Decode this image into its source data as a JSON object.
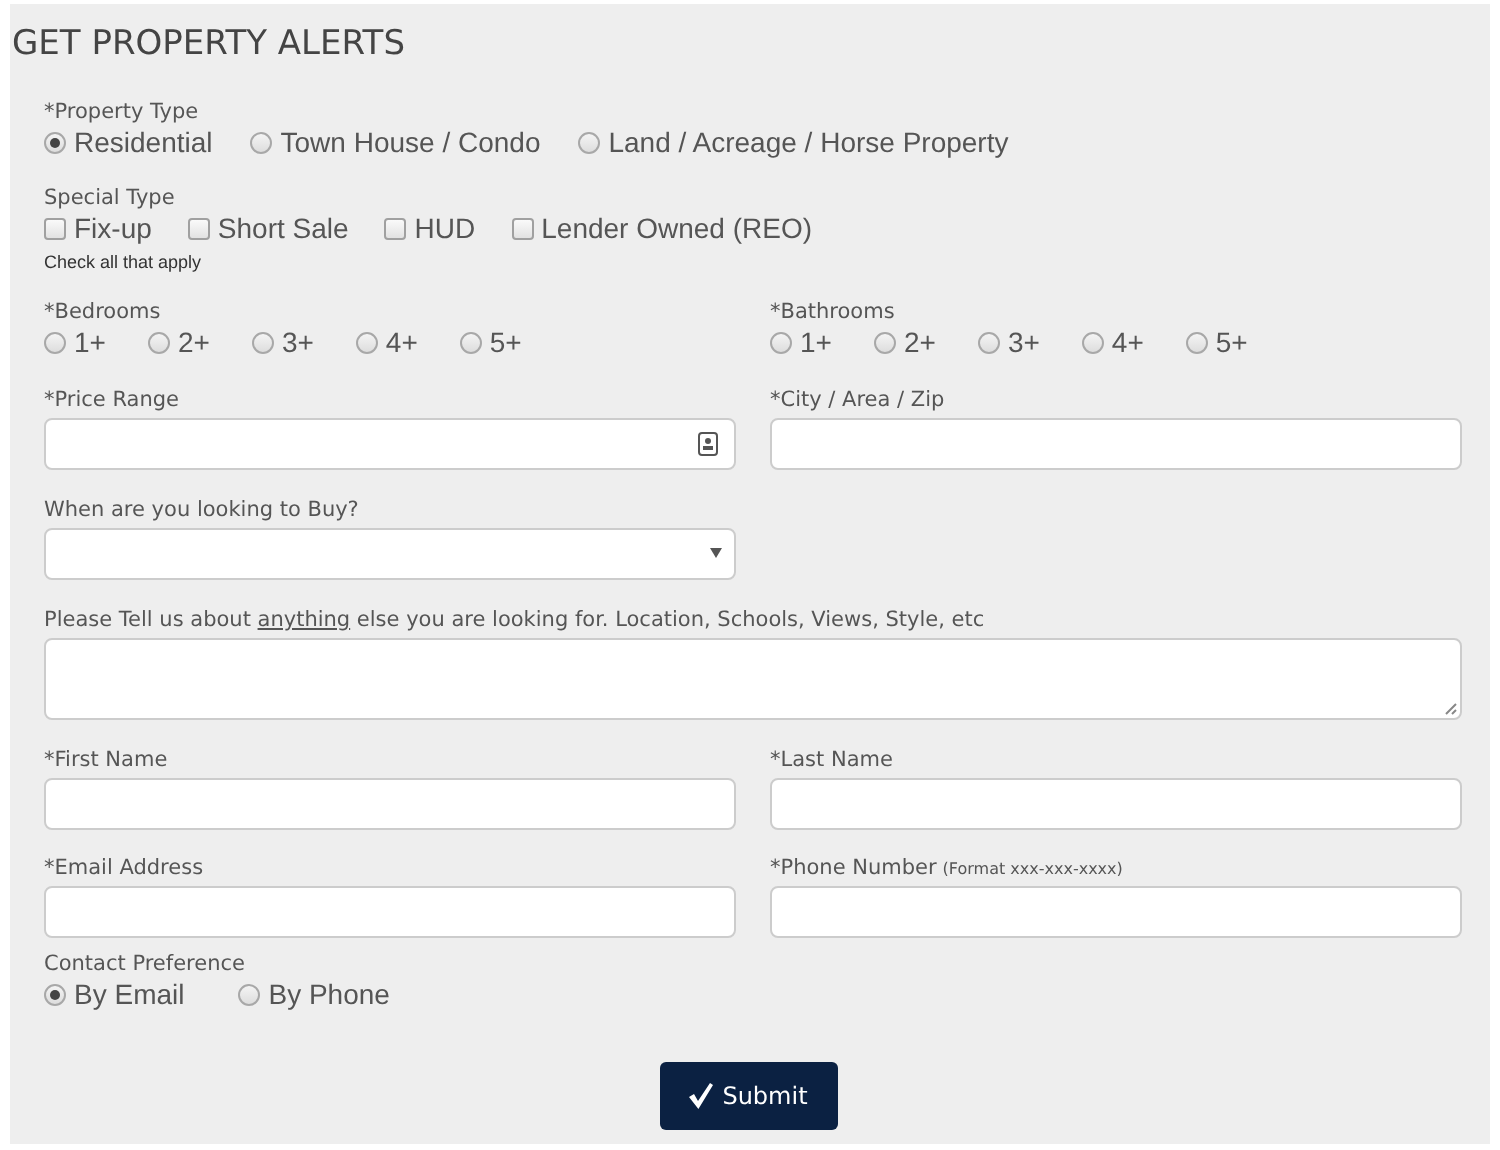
{
  "title": "GET PROPERTY ALERTS",
  "property_type": {
    "label": "*Property Type",
    "options": [
      {
        "label": "Residential",
        "selected": true
      },
      {
        "label": "Town House / Condo",
        "selected": false
      },
      {
        "label": "Land / Acreage / Horse Property",
        "selected": false
      }
    ]
  },
  "special_type": {
    "label": "Special Type",
    "hint": "Check all that apply",
    "options": [
      {
        "label": "Fix-up",
        "checked": false
      },
      {
        "label": "Short Sale",
        "checked": false
      },
      {
        "label": "HUD",
        "checked": false
      },
      {
        "label": "Lender Owned (REO)",
        "checked": false
      }
    ]
  },
  "bedrooms": {
    "label": "*Bedrooms",
    "options": [
      {
        "label": "1+",
        "selected": false
      },
      {
        "label": "2+",
        "selected": false
      },
      {
        "label": "3+",
        "selected": false
      },
      {
        "label": "4+",
        "selected": false
      },
      {
        "label": "5+",
        "selected": false
      }
    ]
  },
  "bathrooms": {
    "label": "*Bathrooms",
    "options": [
      {
        "label": "1+",
        "selected": false
      },
      {
        "label": "2+",
        "selected": false
      },
      {
        "label": "3+",
        "selected": false
      },
      {
        "label": "4+",
        "selected": false
      },
      {
        "label": "5+",
        "selected": false
      }
    ]
  },
  "price_range": {
    "label": "*Price Range"
  },
  "city": {
    "label": "*City / Area / Zip"
  },
  "buy_when": {
    "label": "When are you looking to Buy?"
  },
  "notes": {
    "text_before": "Please Tell us about",
    "link": "anything",
    "text_after": "else you are looking for. Location, Schools, Views, Style, etc"
  },
  "first_name": {
    "label": "*First Name"
  },
  "last_name": {
    "label": "*Last Name"
  },
  "email": {
    "label": "*Email Address"
  },
  "phone": {
    "label": "*Phone Number",
    "note": "(Format xxx-xxx-xxxx)"
  },
  "contact_preference": {
    "label": "Contact Preference",
    "options": [
      {
        "label": "By Email",
        "selected": true
      },
      {
        "label": "By Phone",
        "selected": false
      }
    ]
  },
  "submit": {
    "label": "Submit"
  }
}
